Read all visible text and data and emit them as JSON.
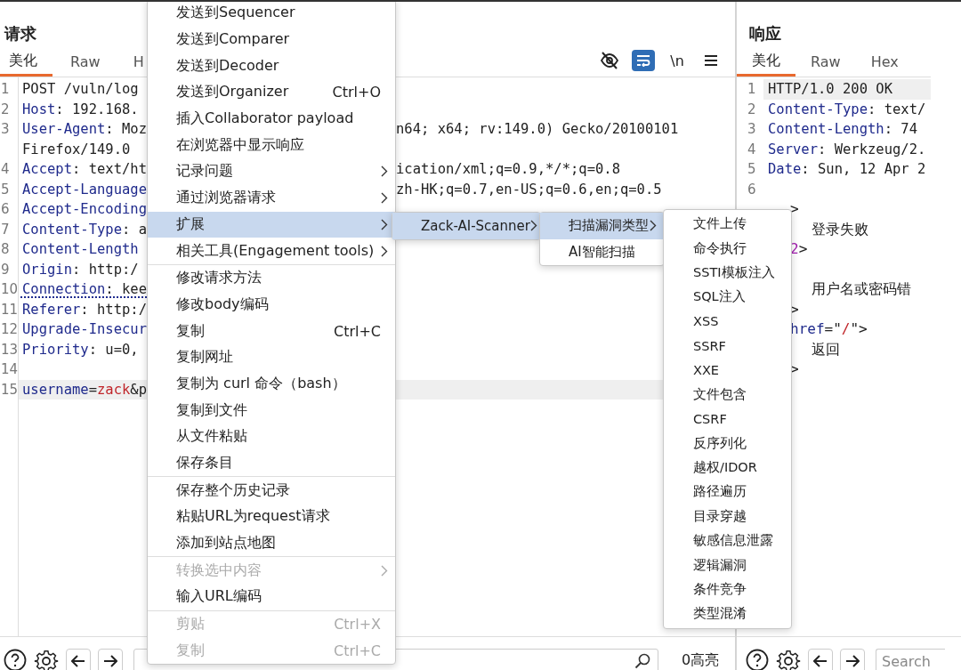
{
  "request": {
    "title": "请求",
    "tabs": [
      {
        "label": "美化",
        "selected": true
      },
      {
        "label": "Raw",
        "selected": false
      },
      {
        "label": "H",
        "selected": false
      }
    ],
    "toolbar": [
      {
        "kind": "hide",
        "on": false
      },
      {
        "kind": "wrap",
        "on": true
      },
      {
        "kind": "newline",
        "label": "\\n",
        "on": false
      },
      {
        "kind": "menu",
        "on": false
      }
    ],
    "lines": [
      {
        "number": "1",
        "current": false,
        "flagged": false,
        "parts": [
          {
            "kind": "plain",
            "text": "POST /vuln/log"
          }
        ]
      },
      {
        "number": "2",
        "current": false,
        "flagged": false,
        "parts": [
          {
            "kind": "name",
            "text": "Host"
          },
          {
            "kind": "plain",
            "text": ": 192.168."
          }
        ]
      },
      {
        "number": "3",
        "current": false,
        "flagged": false,
        "parts": [
          {
            "kind": "name",
            "text": "User-Agent"
          },
          {
            "kind": "plain",
            "text": ": Moz"
          }
        ],
        "tail": "n64; x64; rv:149.0) Gecko/20100101"
      },
      {
        "current": false,
        "flagged": false,
        "parts": [
          {
            "kind": "plain",
            "text": "Firefox/149.0"
          }
        ]
      },
      {
        "number": "4",
        "current": false,
        "flagged": false,
        "parts": [
          {
            "kind": "name",
            "text": "Accept"
          },
          {
            "kind": "plain",
            "text": ": text/ht"
          }
        ],
        "tail": "ication/xml;q=0.9,*/*;q=0.8"
      },
      {
        "number": "5",
        "current": false,
        "flagged": false,
        "parts": [
          {
            "kind": "name",
            "text": "Accept-Language"
          }
        ],
        "tail": "zh-HK;q=0.7,en-US;q=0.6,en;q=0.5"
      },
      {
        "number": "6",
        "current": false,
        "flagged": false,
        "parts": [
          {
            "kind": "name",
            "text": "Accept-Encoding"
          }
        ]
      },
      {
        "number": "7",
        "current": false,
        "flagged": false,
        "parts": [
          {
            "kind": "name",
            "text": "Content-Type"
          },
          {
            "kind": "plain",
            "text": ": a"
          }
        ]
      },
      {
        "number": "8",
        "current": false,
        "flagged": false,
        "parts": [
          {
            "kind": "name",
            "text": "Content-Length"
          }
        ]
      },
      {
        "number": "9",
        "current": false,
        "flagged": false,
        "parts": [
          {
            "kind": "name",
            "text": "Origin"
          },
          {
            "kind": "plain",
            "text": ": http:/"
          }
        ]
      },
      {
        "number": "10",
        "current": false,
        "flagged": true,
        "parts": [
          {
            "kind": "name",
            "text": "Connection"
          },
          {
            "kind": "plain",
            "text": ": kee"
          }
        ]
      },
      {
        "number": "11",
        "current": false,
        "flagged": false,
        "parts": [
          {
            "kind": "name",
            "text": "Referer"
          },
          {
            "kind": "plain",
            "text": ": http:/"
          }
        ]
      },
      {
        "number": "12",
        "current": false,
        "flagged": false,
        "parts": [
          {
            "kind": "name",
            "text": "Upgrade-Insecur"
          }
        ]
      },
      {
        "number": "13",
        "current": false,
        "flagged": false,
        "parts": [
          {
            "kind": "name",
            "text": "Priority"
          },
          {
            "kind": "plain",
            "text": ": u=0,"
          }
        ]
      },
      {
        "number": "14",
        "current": false,
        "flagged": false
      },
      {
        "number": "15",
        "current": true,
        "flagged": false,
        "parts": [
          {
            "kind": "name",
            "text": "username"
          },
          {
            "kind": "plain",
            "text": "="
          },
          {
            "kind": "value",
            "text": "zack"
          },
          {
            "kind": "plain",
            "text": "&p"
          }
        ]
      }
    ],
    "footer": {
      "highlights": "0高亮"
    }
  },
  "response": {
    "title": "响应",
    "tabs": [
      {
        "label": "美化",
        "selected": true
      },
      {
        "label": "Raw",
        "selected": false
      },
      {
        "label": "Hex",
        "selected": false
      }
    ],
    "lines": [
      {
        "number": "1",
        "current": true,
        "parts": [
          {
            "kind": "plain",
            "text": "HTTP/1.0 200 OK"
          }
        ]
      },
      {
        "number": "2",
        "current": false,
        "parts": [
          {
            "kind": "name",
            "text": "Content-Type"
          },
          {
            "kind": "plain",
            "text": ": text/"
          }
        ]
      },
      {
        "number": "3",
        "current": false,
        "parts": [
          {
            "kind": "name",
            "text": "Content-Length"
          },
          {
            "kind": "plain",
            "text": ": 74"
          }
        ]
      },
      {
        "number": "4",
        "current": false,
        "parts": [
          {
            "kind": "name",
            "text": "Server"
          },
          {
            "kind": "plain",
            "text": ": Werkzeug/2."
          }
        ]
      },
      {
        "number": "5",
        "current": false,
        "parts": [
          {
            "kind": "name",
            "text": "Date"
          },
          {
            "kind": "plain",
            "text": ": Sun, 12 Apr 2"
          }
        ]
      },
      {
        "number": "6",
        "current": false
      }
    ],
    "tail_blocks": [
      [
        {
          "indent": false,
          "parts": [
            {
              "kind": "plain",
              "text": ">"
            }
          ]
        },
        {
          "indent": true,
          "parts": [
            {
              "kind": "plain",
              "text": "登录失败"
            }
          ]
        },
        {
          "indent": false,
          "parts": [
            {
              "kind": "tag",
              "text": "2"
            },
            {
              "kind": "plain",
              "text": ">"
            }
          ]
        }
      ],
      [
        {
          "indent": true,
          "parts": [
            {
              "kind": "plain",
              "text": "用户名或密码错"
            }
          ]
        },
        {
          "indent": false,
          "parts": [
            {
              "kind": "plain",
              "text": ">"
            }
          ]
        },
        {
          "indent": false,
          "parts": [
            {
              "kind": "name",
              "text": "href"
            },
            {
              "kind": "plain",
              "text": "=\""
            },
            {
              "kind": "value",
              "text": "/"
            },
            {
              "kind": "plain",
              "text": "\">"
            }
          ]
        },
        {
          "indent": true,
          "parts": [
            {
              "kind": "plain",
              "text": "返回"
            }
          ]
        },
        {
          "indent": false,
          "parts": [
            {
              "kind": "plain",
              "text": ">"
            }
          ]
        }
      ]
    ],
    "footer": {
      "search": {
        "placeholder": "Search"
      }
    }
  },
  "menus": [
    {
      "groups": [
        [
          {
            "label": "发送到Sequencer",
            "submenu": false,
            "disabled": false,
            "selected": false
          },
          {
            "label": "发送到Comparer",
            "submenu": false,
            "disabled": false,
            "selected": false
          },
          {
            "label": "发送到Decoder",
            "submenu": false,
            "disabled": false,
            "selected": false
          },
          {
            "label": "发送到Organizer",
            "shortcut": "Ctrl+O",
            "submenu": false,
            "disabled": false,
            "selected": false
          },
          {
            "label": "插入Collaborator payload",
            "submenu": false,
            "disabled": false,
            "selected": false
          },
          {
            "label": "在浏览器中显示响应",
            "submenu": false,
            "disabled": false,
            "selected": false
          },
          {
            "label": "记录问题",
            "submenu": true,
            "disabled": false,
            "selected": false
          },
          {
            "label": "通过浏览器请求",
            "submenu": true,
            "disabled": false,
            "selected": false
          },
          {
            "label": "扩展",
            "submenu": true,
            "disabled": false,
            "selected": true
          },
          {
            "label": "相关工具(Engagement tools)",
            "submenu": true,
            "disabled": false,
            "selected": false
          }
        ],
        [
          {
            "label": "修改请求方法",
            "submenu": false,
            "disabled": false,
            "selected": false
          },
          {
            "label": "修改body编码",
            "submenu": false,
            "disabled": false,
            "selected": false
          },
          {
            "label": "复制",
            "shortcut": "Ctrl+C",
            "submenu": false,
            "disabled": false,
            "selected": false
          },
          {
            "label": "复制网址",
            "submenu": false,
            "disabled": false,
            "selected": false
          },
          {
            "label": "复制为 curl 命令（bash）",
            "submenu": false,
            "disabled": false,
            "selected": false
          },
          {
            "label": "复制到文件",
            "submenu": false,
            "disabled": false,
            "selected": false
          },
          {
            "label": "从文件粘贴",
            "submenu": false,
            "disabled": false,
            "selected": false
          },
          {
            "label": "保存条目",
            "submenu": false,
            "disabled": false,
            "selected": false
          }
        ],
        [
          {
            "label": "保存整个历史记录",
            "submenu": false,
            "disabled": false,
            "selected": false
          },
          {
            "label": "粘贴URL为request请求",
            "submenu": false,
            "disabled": false,
            "selected": false
          },
          {
            "label": "添加到站点地图",
            "submenu": false,
            "disabled": false,
            "selected": false
          }
        ],
        [
          {
            "label": "转换选中内容",
            "submenu": true,
            "disabled": true,
            "selected": false
          },
          {
            "label": "输入URL编码",
            "submenu": false,
            "disabled": false,
            "selected": false
          }
        ],
        [
          {
            "label": "剪贴",
            "shortcut": "Ctrl+X",
            "submenu": false,
            "disabled": true,
            "selected": false
          },
          {
            "label": "复制",
            "shortcut": "Ctrl+C",
            "submenu": false,
            "disabled": true,
            "selected": false
          }
        ]
      ]
    },
    {
      "groups": [
        [
          {
            "label": "Zack-AI-Scanner",
            "submenu": true,
            "disabled": false,
            "selected": true
          }
        ]
      ]
    },
    {
      "groups": [
        [
          {
            "label": "扫描漏洞类型",
            "submenu": true,
            "disabled": false,
            "selected": true
          },
          {
            "label": "AI智能扫描",
            "submenu": false,
            "disabled": false,
            "selected": false
          }
        ]
      ]
    },
    {
      "groups": [
        [
          {
            "label": "文件上传",
            "submenu": false,
            "disabled": false,
            "selected": false
          },
          {
            "label": "命令执行",
            "submenu": false,
            "disabled": false,
            "selected": false
          },
          {
            "label": "SSTI模板注入",
            "submenu": false,
            "disabled": false,
            "selected": false
          },
          {
            "label": "SQL注入",
            "submenu": false,
            "disabled": false,
            "selected": false
          },
          {
            "label": "XSS",
            "submenu": false,
            "disabled": false,
            "selected": false
          },
          {
            "label": "SSRF",
            "submenu": false,
            "disabled": false,
            "selected": false
          },
          {
            "label": "XXE",
            "submenu": false,
            "disabled": false,
            "selected": false
          },
          {
            "label": "文件包含",
            "submenu": false,
            "disabled": false,
            "selected": false
          },
          {
            "label": "CSRF",
            "submenu": false,
            "disabled": false,
            "selected": false
          },
          {
            "label": "反序列化",
            "submenu": false,
            "disabled": false,
            "selected": false
          },
          {
            "label": "越权/IDOR",
            "submenu": false,
            "disabled": false,
            "selected": false
          },
          {
            "label": "路径遍历",
            "submenu": false,
            "disabled": false,
            "selected": false
          },
          {
            "label": "目录穿越",
            "submenu": false,
            "disabled": false,
            "selected": false
          },
          {
            "label": "敏感信息泄露",
            "submenu": false,
            "disabled": false,
            "selected": false
          },
          {
            "label": "逻辑漏洞",
            "submenu": false,
            "disabled": false,
            "selected": false
          },
          {
            "label": "条件竞争",
            "submenu": false,
            "disabled": false,
            "selected": false
          },
          {
            "label": "类型混淆",
            "submenu": false,
            "disabled": false,
            "selected": false
          }
        ]
      ]
    }
  ]
}
